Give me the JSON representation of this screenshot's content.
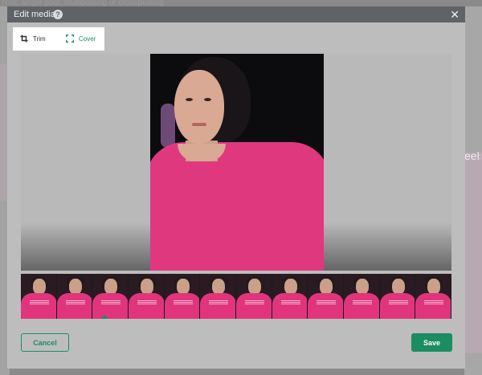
{
  "background": {
    "top_text": "post: single post, multiposting or crossposting",
    "right_text": "eels"
  },
  "modal": {
    "title": "Edit media",
    "help_glyph": "?",
    "close_glyph": "✕",
    "tabs": [
      {
        "label": "Trim",
        "icon": "crop-icon",
        "active": false
      },
      {
        "label": "Cover",
        "icon": "expand-icon",
        "active": true
      }
    ],
    "filmstrip_frame_count": 12,
    "cancel_label": "Cancel",
    "save_label": "Save"
  },
  "colors": {
    "accent": "#1c8c63",
    "header": "#5f6368",
    "modal_body": "#bdbdbd",
    "shirt": "#e0387f"
  }
}
